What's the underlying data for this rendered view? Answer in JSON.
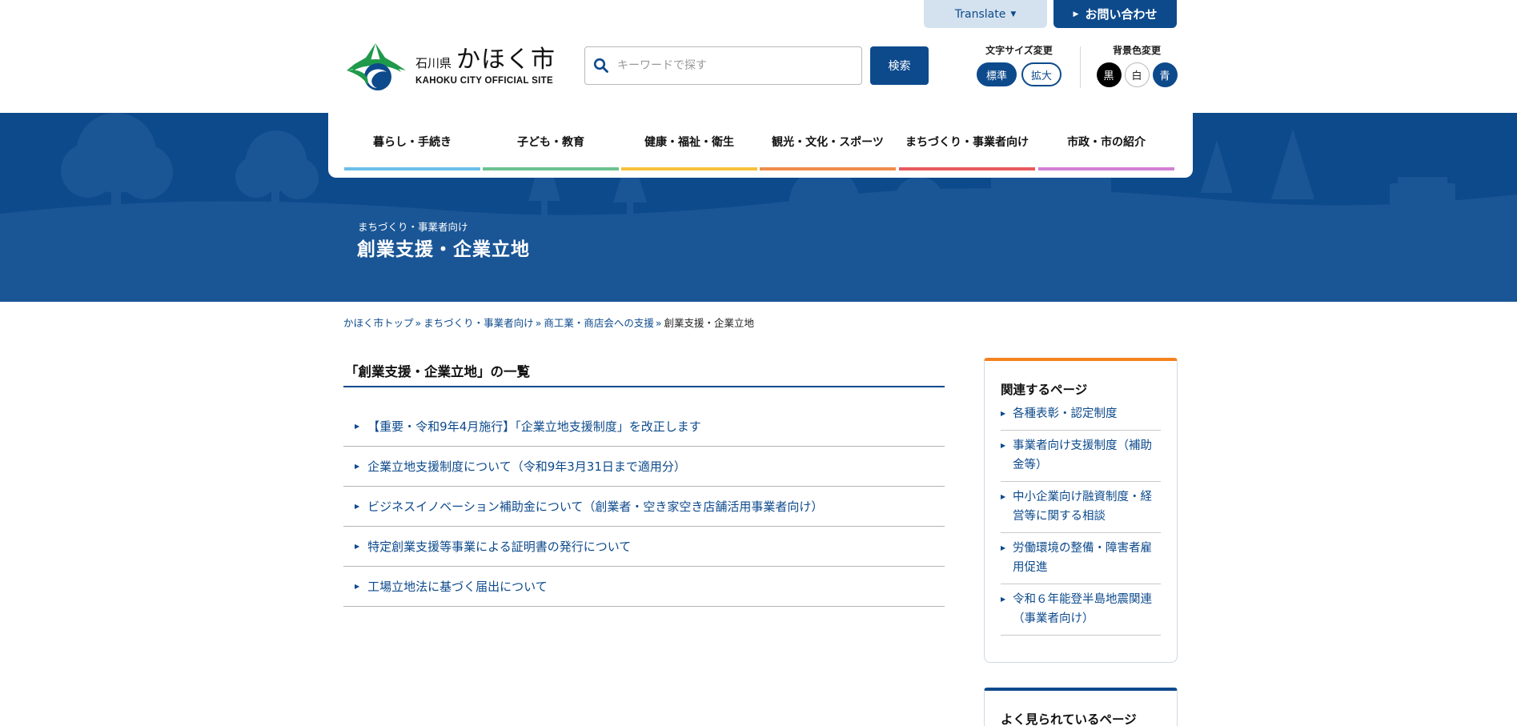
{
  "utility": {
    "translate_label": "Translate",
    "contact_label": "お問い合わせ"
  },
  "logo": {
    "prefecture": "石川県",
    "city": "かほく市",
    "subtitle": "KAHOKU CITY OFFICIAL SITE"
  },
  "search": {
    "placeholder": "キーワードで探す",
    "button_label": "検索"
  },
  "font_size": {
    "title": "文字サイズ変更",
    "standard_label": "標準",
    "large_label": "拡大"
  },
  "bg_color": {
    "title": "背景色変更",
    "black_label": "黒",
    "white_label": "白",
    "blue_label": "青"
  },
  "global_nav": {
    "items": [
      {
        "label": "暮らし・手続き",
        "color": "#6bbfe8"
      },
      {
        "label": "子ども・教育",
        "color": "#6cc28f"
      },
      {
        "label": "健康・福祉・衛生",
        "color": "#f5c23a"
      },
      {
        "label": "観光・文化・スポーツ",
        "color": "#ef8d4b"
      },
      {
        "label": "まちづくり・事業者向け",
        "color": "#e85a5e"
      },
      {
        "label": "市政・市の紹介",
        "color": "#d27fd6"
      }
    ]
  },
  "hero": {
    "category": "まちづくり・事業者向け",
    "title": "創業支援・企業立地"
  },
  "breadcrumb": {
    "items": [
      "かほく市トップ",
      "まちづくり・事業者向け",
      "商工業・商店会への支援"
    ],
    "current": "創業支援・企業立地",
    "separator": "»"
  },
  "main": {
    "title": "「創業支援・企業立地」の一覧",
    "links": [
      "【重要・令和9年4月施行】「企業立地支援制度」を改正します",
      "企業立地支援制度について（令和9年3月31日まで適用分）",
      "ビジネスイノベーション補助金について（創業者・空き家空き店舗活用事業者向け）",
      "特定創業支援等事業による証明書の発行について",
      "工場立地法に基づく届出について"
    ]
  },
  "sidebar": {
    "related_title": "関連するページ",
    "related_links": [
      "各種表彰・認定制度",
      "事業者向け支援制度（補助金等）",
      "中小企業向け融資制度・経営等に関する相談",
      "労働環境の整備・障害者雇用促進",
      "令和６年能登半島地震関連（事業者向け）"
    ],
    "popular_title": "よく見られているページ"
  },
  "colors": {
    "brand_blue": "#0d4a8c",
    "accent_orange": "#f58220"
  }
}
